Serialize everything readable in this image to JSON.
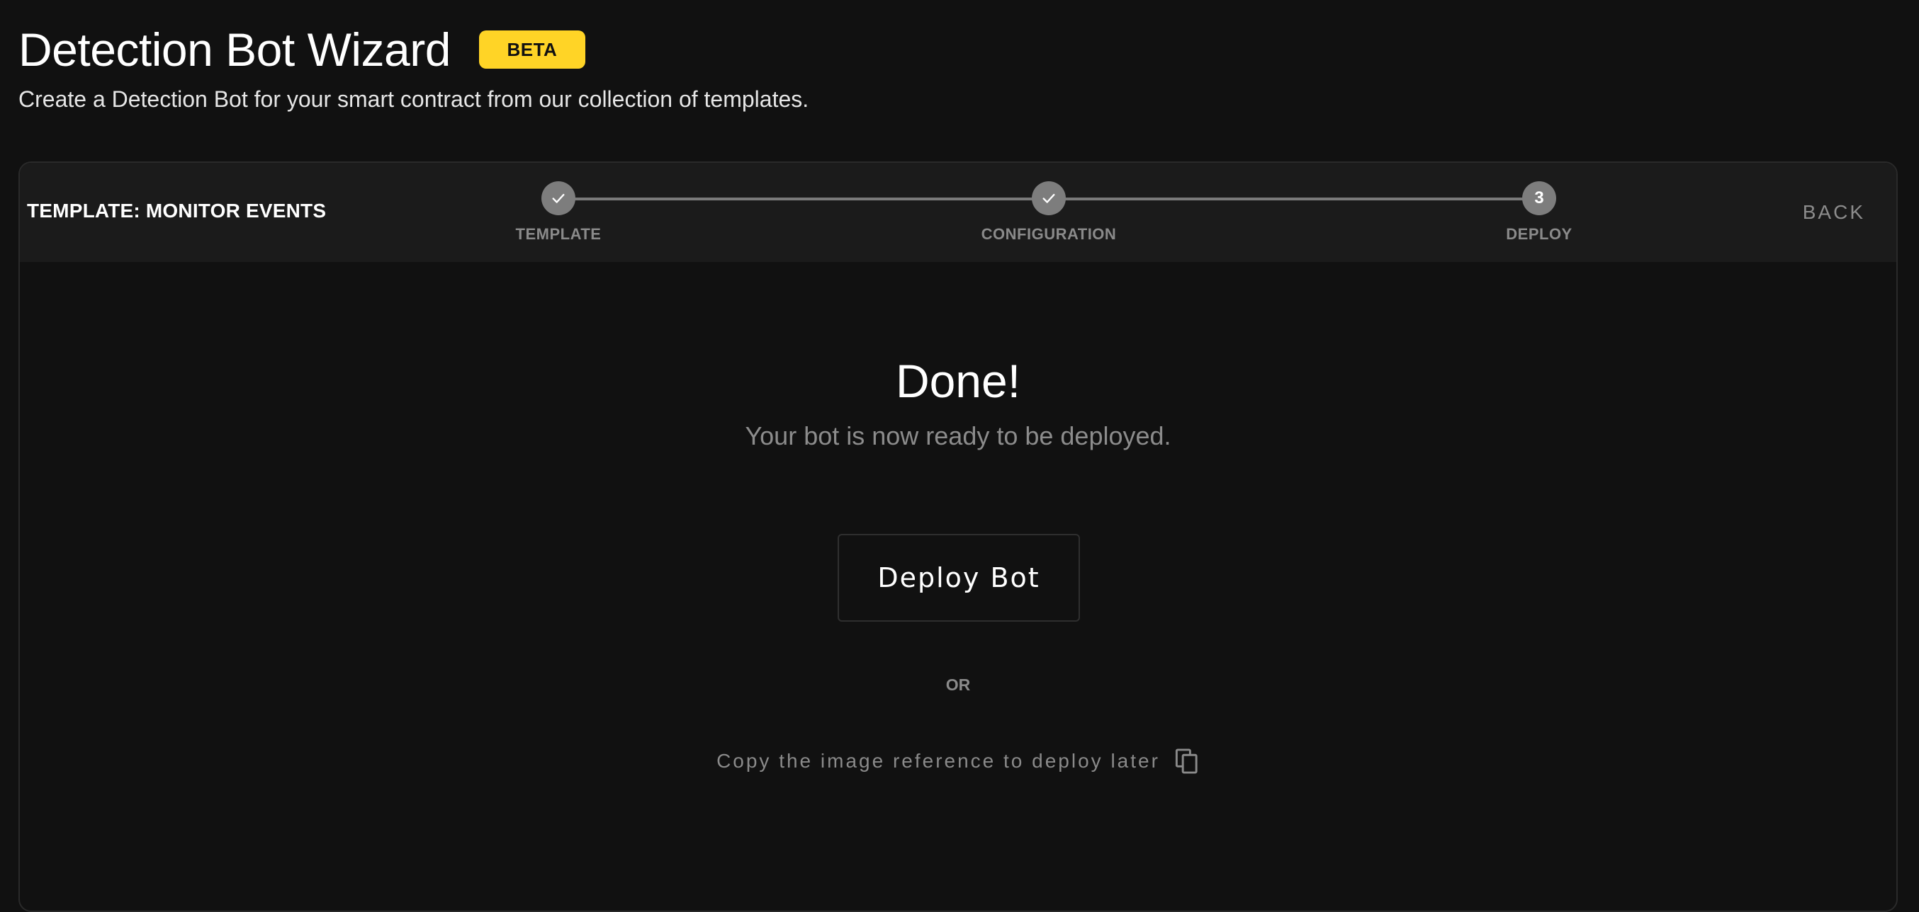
{
  "header": {
    "title": "Detection Bot Wizard",
    "badge": "BETA",
    "subtitle": "Create a Detection Bot for your smart contract from our collection of templates."
  },
  "wizard": {
    "template_label": "TEMPLATE: MONITOR EVENTS",
    "back_label": "BACK",
    "steps": [
      {
        "label": "TEMPLATE",
        "status": "completed",
        "icon": "check-icon"
      },
      {
        "label": "CONFIGURATION",
        "status": "completed",
        "icon": "check-icon"
      },
      {
        "label": "DEPLOY",
        "status": "current",
        "number": "3"
      }
    ]
  },
  "result": {
    "title": "Done!",
    "subtitle": "Your bot is now ready to be deployed.",
    "deploy_button": "Deploy Bot",
    "or_label": "OR",
    "copy_text": "Copy the image reference to deploy later",
    "copy_icon": "copy-icon"
  },
  "colors": {
    "background": "#111111",
    "header_bar": "#1b1b1b",
    "badge": "#ffd426",
    "step_circle": "#7d7d7d",
    "muted_text": "#8a8a8a"
  }
}
